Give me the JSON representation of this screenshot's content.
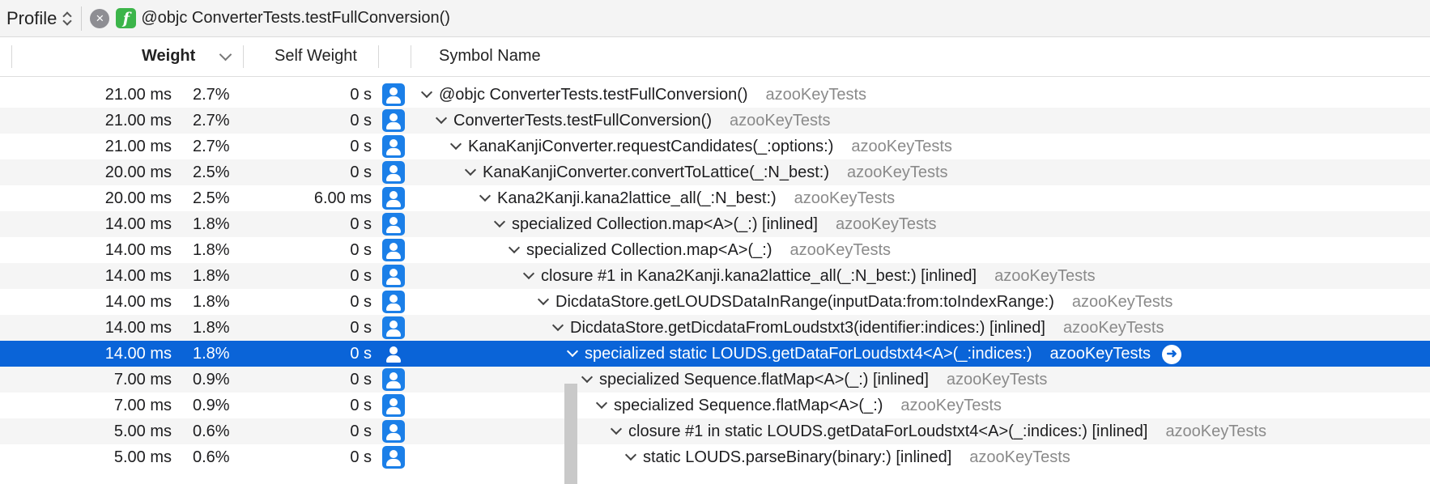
{
  "topbar": {
    "profile_label": "Profile",
    "breadcrumb": "@objc ConverterTests.testFullConversion()",
    "clear_icon": "x-circle-icon",
    "function_icon": "function-badge-icon"
  },
  "header": {
    "weight": "Weight",
    "self_weight": "Self Weight",
    "symbol_name": "Symbol Name"
  },
  "colors": {
    "selection": "#0a64d8",
    "user_icon": "#1b7fe8",
    "fn_badge": "#3cb54a"
  },
  "rows": [
    {
      "weight": "21.00 ms",
      "pct": "2.7%",
      "self": "0 s",
      "symbol": "@objc ConverterTests.testFullConversion()",
      "lib": "azooKeyTests"
    },
    {
      "weight": "21.00 ms",
      "pct": "2.7%",
      "self": "0 s",
      "symbol": "ConverterTests.testFullConversion()",
      "lib": "azooKeyTests"
    },
    {
      "weight": "21.00 ms",
      "pct": "2.7%",
      "self": "0 s",
      "symbol": "KanaKanjiConverter.requestCandidates(_:options:)",
      "lib": "azooKeyTests"
    },
    {
      "weight": "20.00 ms",
      "pct": "2.5%",
      "self": "0 s",
      "symbol": "KanaKanjiConverter.convertToLattice(_:N_best:)",
      "lib": "azooKeyTests"
    },
    {
      "weight": "20.00 ms",
      "pct": "2.5%",
      "self": "6.00 ms",
      "symbol": "Kana2Kanji.kana2lattice_all(_:N_best:)",
      "lib": "azooKeyTests"
    },
    {
      "weight": "14.00 ms",
      "pct": "1.8%",
      "self": "0 s",
      "symbol": "specialized Collection.map<A>(_:) [inlined]",
      "lib": "azooKeyTests"
    },
    {
      "weight": "14.00 ms",
      "pct": "1.8%",
      "self": "0 s",
      "symbol": "specialized Collection.map<A>(_:)",
      "lib": "azooKeyTests"
    },
    {
      "weight": "14.00 ms",
      "pct": "1.8%",
      "self": "0 s",
      "symbol": "closure #1 in Kana2Kanji.kana2lattice_all(_:N_best:) [inlined]",
      "lib": "azooKeyTests"
    },
    {
      "weight": "14.00 ms",
      "pct": "1.8%",
      "self": "0 s",
      "symbol": "DicdataStore.getLOUDSDataInRange(inputData:from:toIndexRange:)",
      "lib": "azooKeyTests"
    },
    {
      "weight": "14.00 ms",
      "pct": "1.8%",
      "self": "0 s",
      "symbol": "DicdataStore.getDicdataFromLoudstxt3(identifier:indices:) [inlined]",
      "lib": "azooKeyTests"
    },
    {
      "weight": "14.00 ms",
      "pct": "1.8%",
      "self": "0 s",
      "symbol": "specialized static LOUDS.getDataForLoudstxt4<A>(_:indices:)",
      "lib": "azooKeyTests",
      "selected": true
    },
    {
      "weight": "7.00 ms",
      "pct": "0.9%",
      "self": "0 s",
      "symbol": "specialized Sequence.flatMap<A>(_:) [inlined]",
      "lib": "azooKeyTests"
    },
    {
      "weight": "7.00 ms",
      "pct": "0.9%",
      "self": "0 s",
      "symbol": "specialized Sequence.flatMap<A>(_:)",
      "lib": "azooKeyTests"
    },
    {
      "weight": "5.00 ms",
      "pct": "0.6%",
      "self": "0 s",
      "symbol": "closure #1 in static LOUDS.getDataForLoudstxt4<A>(_:indices:) [inlined]",
      "lib": "azooKeyTests"
    },
    {
      "weight": "5.00 ms",
      "pct": "0.6%",
      "self": "0 s",
      "symbol": "static LOUDS.parseBinary(binary:) [inlined]",
      "lib": "azooKeyTests"
    }
  ]
}
